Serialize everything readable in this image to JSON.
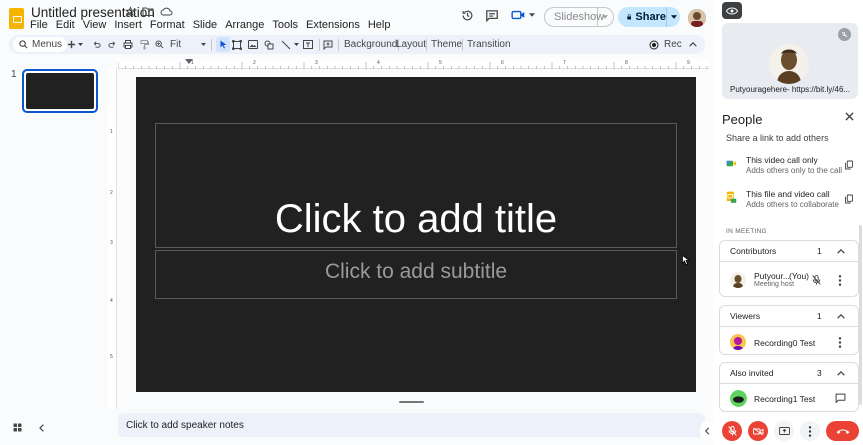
{
  "app": {
    "doc_title": "Untitled presentation",
    "menu": [
      "File",
      "Edit",
      "View",
      "Insert",
      "Format",
      "Slide",
      "Arrange",
      "Tools",
      "Extensions",
      "Help"
    ]
  },
  "header": {
    "slideshow_label": "Slideshow",
    "share_label": "Share"
  },
  "toolbar": {
    "menus_label": "Menus",
    "zoom_label": "Fit",
    "background_label": "Background",
    "layout_label": "Layout",
    "theme_label": "Theme",
    "transition_label": "Transition",
    "rec_label": "Rec"
  },
  "filmstrip": {
    "slides": [
      {
        "number": "1"
      }
    ]
  },
  "ruler": {
    "h_numbers": [
      "1",
      "2",
      "3",
      "4",
      "5",
      "6",
      "7",
      "8",
      "9"
    ],
    "v_numbers": [
      "1",
      "2",
      "3",
      "4",
      "5"
    ]
  },
  "slide": {
    "title_placeholder": "Click to add title",
    "subtitle_placeholder": "Click to add subtitle"
  },
  "notes": {
    "placeholder": "Click to add speaker notes"
  },
  "meet": {
    "tile_name": "Putyouragehere- https://bit.ly/46...",
    "people_title": "People",
    "share_link_text": "Share a link to add others",
    "option1_title": "This video call only",
    "option1_sub": "Adds others only to the call",
    "option2_title": "This file and video call",
    "option2_sub": "Adds others to collaborate",
    "in_meeting_label": "IN MEETING",
    "contributors": {
      "label": "Contributors",
      "count": "1",
      "people": [
        {
          "name": "Putyour...",
          "you": "(You)",
          "role": "Meeting host"
        }
      ]
    },
    "viewers": {
      "label": "Viewers",
      "count": "1",
      "people": [
        {
          "name": "Recording0 Test"
        }
      ]
    },
    "also_invited": {
      "label": "Also invited",
      "count": "3",
      "people": [
        {
          "name": "Recording1 Test"
        }
      ]
    }
  },
  "colors": {
    "accent": "#0b57d0",
    "share_bg": "#c2e7ff",
    "slide_bg": "#212121",
    "hangup": "#ea4335",
    "mic_off": "#ea4335"
  }
}
